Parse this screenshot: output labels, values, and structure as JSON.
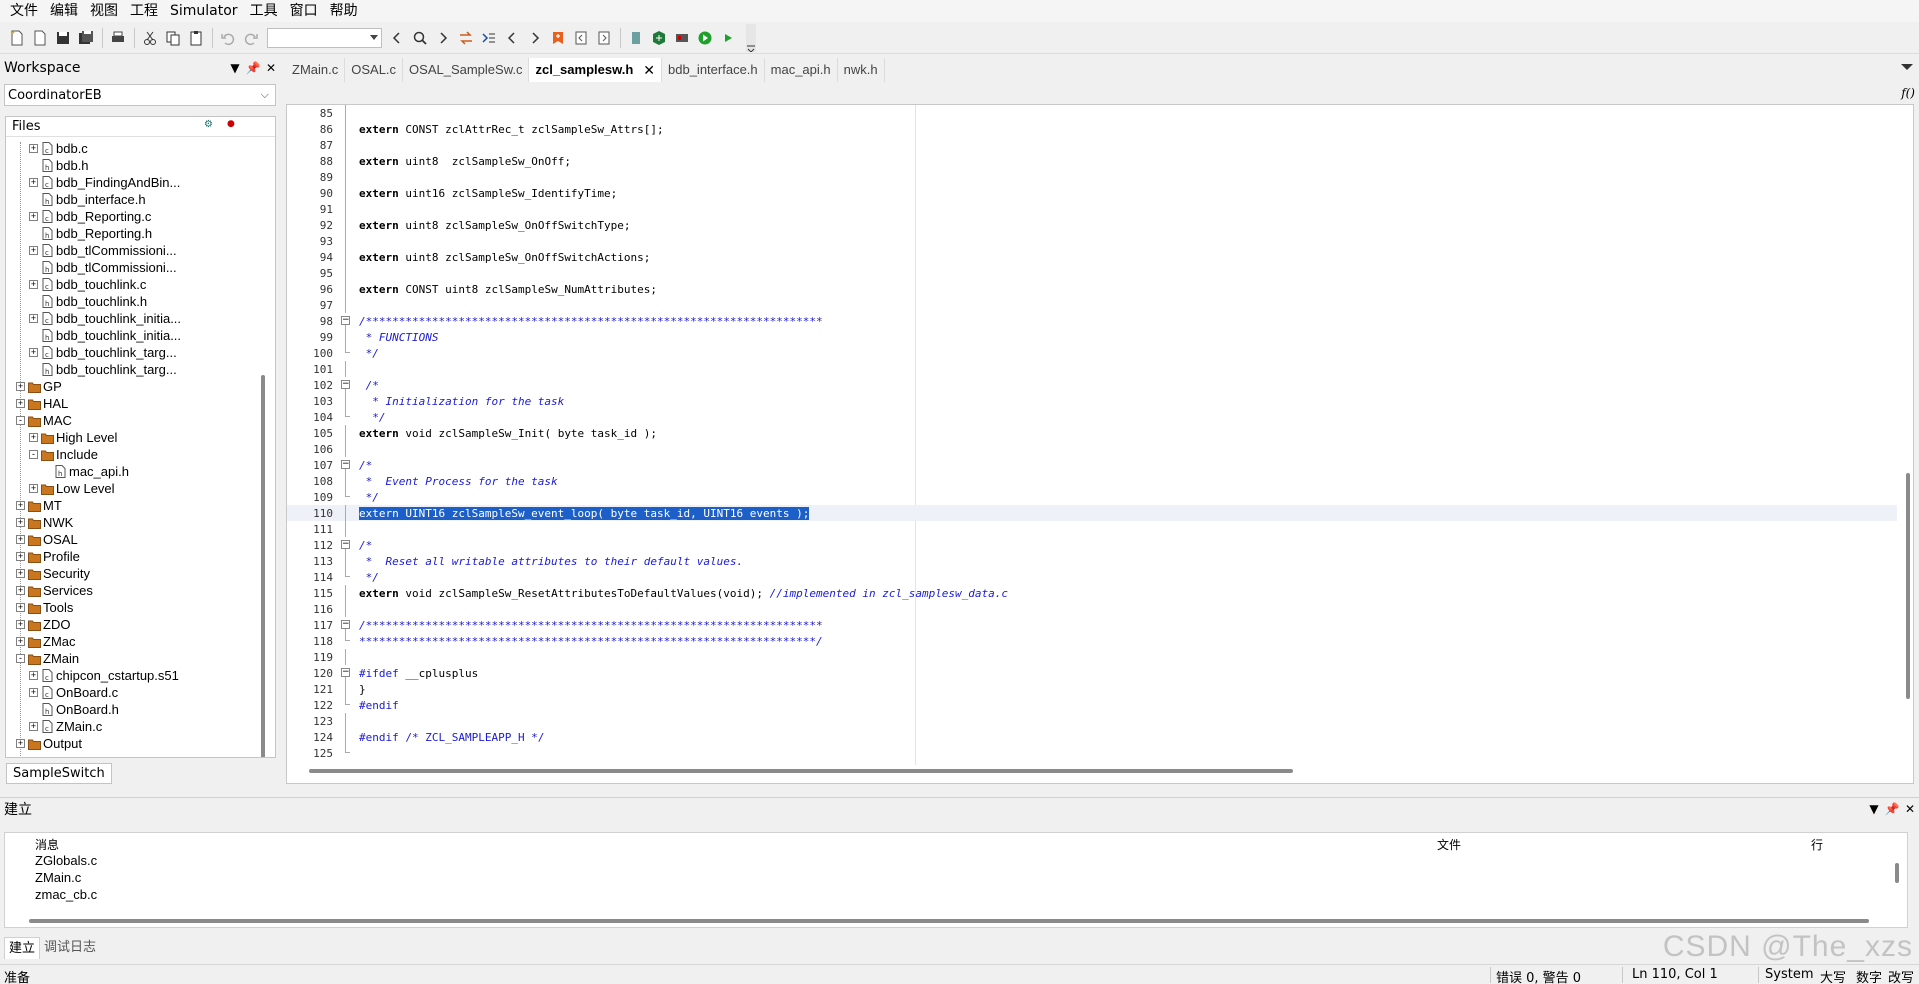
{
  "menu": [
    "文件",
    "编辑",
    "视图",
    "工程",
    "Simulator",
    "工具",
    "窗口",
    "帮助"
  ],
  "workspace": {
    "title": "Workspace",
    "config": "CoordinatorEB",
    "files_header": "Files",
    "bottom_tab": "SampleSwitch",
    "tree": [
      {
        "label": "bdb.c",
        "depth": 2,
        "kind": "c",
        "exp": "+"
      },
      {
        "label": "bdb.h",
        "depth": 2,
        "kind": "h",
        "exp": ""
      },
      {
        "label": "bdb_FindingAndBin...",
        "depth": 2,
        "kind": "c",
        "exp": "+"
      },
      {
        "label": "bdb_interface.h",
        "depth": 2,
        "kind": "h",
        "exp": ""
      },
      {
        "label": "bdb_Reporting.c",
        "depth": 2,
        "kind": "c",
        "exp": "+"
      },
      {
        "label": "bdb_Reporting.h",
        "depth": 2,
        "kind": "h",
        "exp": ""
      },
      {
        "label": "bdb_tlCommissioni...",
        "depth": 2,
        "kind": "c",
        "exp": "+"
      },
      {
        "label": "bdb_tlCommissioni...",
        "depth": 2,
        "kind": "h",
        "exp": ""
      },
      {
        "label": "bdb_touchlink.c",
        "depth": 2,
        "kind": "c",
        "exp": "+"
      },
      {
        "label": "bdb_touchlink.h",
        "depth": 2,
        "kind": "h",
        "exp": ""
      },
      {
        "label": "bdb_touchlink_initia...",
        "depth": 2,
        "kind": "c",
        "exp": "+"
      },
      {
        "label": "bdb_touchlink_initia...",
        "depth": 2,
        "kind": "h",
        "exp": ""
      },
      {
        "label": "bdb_touchlink_targ...",
        "depth": 2,
        "kind": "c",
        "exp": "+"
      },
      {
        "label": "bdb_touchlink_targ...",
        "depth": 2,
        "kind": "h",
        "exp": ""
      },
      {
        "label": "GP",
        "depth": 1,
        "kind": "folder",
        "exp": "+"
      },
      {
        "label": "HAL",
        "depth": 1,
        "kind": "folder",
        "exp": "+"
      },
      {
        "label": "MAC",
        "depth": 1,
        "kind": "folder",
        "exp": "-"
      },
      {
        "label": "High Level",
        "depth": 2,
        "kind": "folder",
        "exp": "+"
      },
      {
        "label": "Include",
        "depth": 2,
        "kind": "folder",
        "exp": "-"
      },
      {
        "label": "mac_api.h",
        "depth": 3,
        "kind": "h",
        "exp": ""
      },
      {
        "label": "Low Level",
        "depth": 2,
        "kind": "folder",
        "exp": "+"
      },
      {
        "label": "MT",
        "depth": 1,
        "kind": "folder",
        "exp": "+"
      },
      {
        "label": "NWK",
        "depth": 1,
        "kind": "folder",
        "exp": "+"
      },
      {
        "label": "OSAL",
        "depth": 1,
        "kind": "folder",
        "exp": "+"
      },
      {
        "label": "Profile",
        "depth": 1,
        "kind": "folder",
        "exp": "+"
      },
      {
        "label": "Security",
        "depth": 1,
        "kind": "folder",
        "exp": "+"
      },
      {
        "label": "Services",
        "depth": 1,
        "kind": "folder",
        "exp": "+"
      },
      {
        "label": "Tools",
        "depth": 1,
        "kind": "folder",
        "exp": "+"
      },
      {
        "label": "ZDO",
        "depth": 1,
        "kind": "folder",
        "exp": "+"
      },
      {
        "label": "ZMac",
        "depth": 1,
        "kind": "folder",
        "exp": "+"
      },
      {
        "label": "ZMain",
        "depth": 1,
        "kind": "folder",
        "exp": "-"
      },
      {
        "label": "chipcon_cstartup.s51",
        "depth": 2,
        "kind": "c",
        "exp": "+"
      },
      {
        "label": "OnBoard.c",
        "depth": 2,
        "kind": "c",
        "exp": "+"
      },
      {
        "label": "OnBoard.h",
        "depth": 2,
        "kind": "h",
        "exp": ""
      },
      {
        "label": "ZMain.c",
        "depth": 2,
        "kind": "c",
        "exp": "+"
      },
      {
        "label": "Output",
        "depth": 1,
        "kind": "folder",
        "exp": "+"
      }
    ]
  },
  "editor": {
    "tabs": [
      "ZMain.c",
      "OSAL.c",
      "OSAL_SampleSw.c",
      "zcl_samplesw.h",
      "bdb_interface.h",
      "mac_api.h",
      "nwk.h"
    ],
    "active_tab_index": 3,
    "function_icon": "f()",
    "lines": [
      {
        "n": "85",
        "fold": "stem",
        "code": ""
      },
      {
        "n": "86",
        "fold": "stem",
        "code": "extern CONST zclAttrRec_t zclSampleSw_Attrs[];"
      },
      {
        "n": "87",
        "fold": "stem",
        "code": ""
      },
      {
        "n": "88",
        "fold": "stem",
        "code": "extern uint8  zclSampleSw_OnOff;"
      },
      {
        "n": "89",
        "fold": "stem",
        "code": ""
      },
      {
        "n": "90",
        "fold": "stem",
        "code": "extern uint16 zclSampleSw_IdentifyTime;"
      },
      {
        "n": "91",
        "fold": "stem",
        "code": ""
      },
      {
        "n": "92",
        "fold": "stem",
        "code": "extern uint8 zclSampleSw_OnOffSwitchType;"
      },
      {
        "n": "93",
        "fold": "stem",
        "code": ""
      },
      {
        "n": "94",
        "fold": "stem",
        "code": "extern uint8 zclSampleSw_OnOffSwitchActions;"
      },
      {
        "n": "95",
        "fold": "stem",
        "code": ""
      },
      {
        "n": "96",
        "fold": "stem",
        "code": "extern CONST uint8 zclSampleSw_NumAttributes;"
      },
      {
        "n": "97",
        "fold": "stem",
        "code": ""
      },
      {
        "n": "98",
        "fold": "box",
        "code": "/*********************************************************************",
        "type": "comment"
      },
      {
        "n": "99",
        "fold": "stem",
        "code": " * FUNCTIONS",
        "type": "comment"
      },
      {
        "n": "100",
        "fold": "end",
        "code": " */",
        "type": "comment"
      },
      {
        "n": "101",
        "fold": "stem",
        "code": ""
      },
      {
        "n": "102",
        "fold": "box",
        "code": " /*",
        "type": "comment"
      },
      {
        "n": "103",
        "fold": "stem",
        "code": "  * Initialization for the task",
        "type": "comment"
      },
      {
        "n": "104",
        "fold": "end",
        "code": "  */",
        "type": "comment"
      },
      {
        "n": "105",
        "fold": "stem",
        "code": "extern void zclSampleSw_Init( byte task_id );"
      },
      {
        "n": "106",
        "fold": "stem",
        "code": ""
      },
      {
        "n": "107",
        "fold": "box",
        "code": "/*",
        "type": "comment"
      },
      {
        "n": "108",
        "fold": "stem",
        "code": " *  Event Process for the task",
        "type": "comment"
      },
      {
        "n": "109",
        "fold": "end",
        "code": " */",
        "type": "comment"
      },
      {
        "n": "110",
        "fold": "stem",
        "code": "extern UINT16 zclSampleSw_event_loop( byte task_id, UINT16 events );",
        "selected": true
      },
      {
        "n": "111",
        "fold": "stem",
        "code": ""
      },
      {
        "n": "112",
        "fold": "box",
        "code": "/*",
        "type": "comment"
      },
      {
        "n": "113",
        "fold": "stem",
        "code": " *  Reset all writable attributes to their default values.",
        "type": "comment"
      },
      {
        "n": "114",
        "fold": "end",
        "code": " */",
        "type": "comment"
      },
      {
        "n": "115",
        "fold": "stem",
        "code": "extern void zclSampleSw_ResetAttributesToDefaultValues(void); ",
        "tail_comment": "//implemented in zcl_samplesw_data.c"
      },
      {
        "n": "116",
        "fold": "stem",
        "code": ""
      },
      {
        "n": "117",
        "fold": "box",
        "code": "/*********************************************************************",
        "type": "comment"
      },
      {
        "n": "118",
        "fold": "end",
        "code": "*********************************************************************/",
        "type": "comment"
      },
      {
        "n": "119",
        "fold": "stem",
        "code": ""
      },
      {
        "n": "120",
        "fold": "box",
        "code": "#ifdef",
        "pp_rest": " __cplusplus",
        "type": "pp"
      },
      {
        "n": "121",
        "fold": "stem",
        "code": "}"
      },
      {
        "n": "122",
        "fold": "end",
        "code": "#endif",
        "type": "pp"
      },
      {
        "n": "123",
        "fold": "stem",
        "code": ""
      },
      {
        "n": "124",
        "fold": "stem",
        "code": "#endif /* ZCL_SAMPLEAPP_H */",
        "type": "pp"
      },
      {
        "n": "125",
        "fold": "end",
        "code": ""
      }
    ]
  },
  "build": {
    "title": "建立",
    "columns": {
      "message": "消息",
      "file": "文件",
      "line": "行"
    },
    "rows": [
      "ZGlobals.c",
      "ZMain.c",
      "zmac_cb.c"
    ],
    "tabs": [
      "建立",
      "调试日志"
    ]
  },
  "status": {
    "ready": "准备",
    "errors": "错误 0, 警告 0",
    "position": "Ln 110, Col 1",
    "encoding": "System",
    "caps": "大写",
    "num": "数字",
    "ovr": "改写"
  },
  "watermark": "CSDN @The_xzs"
}
